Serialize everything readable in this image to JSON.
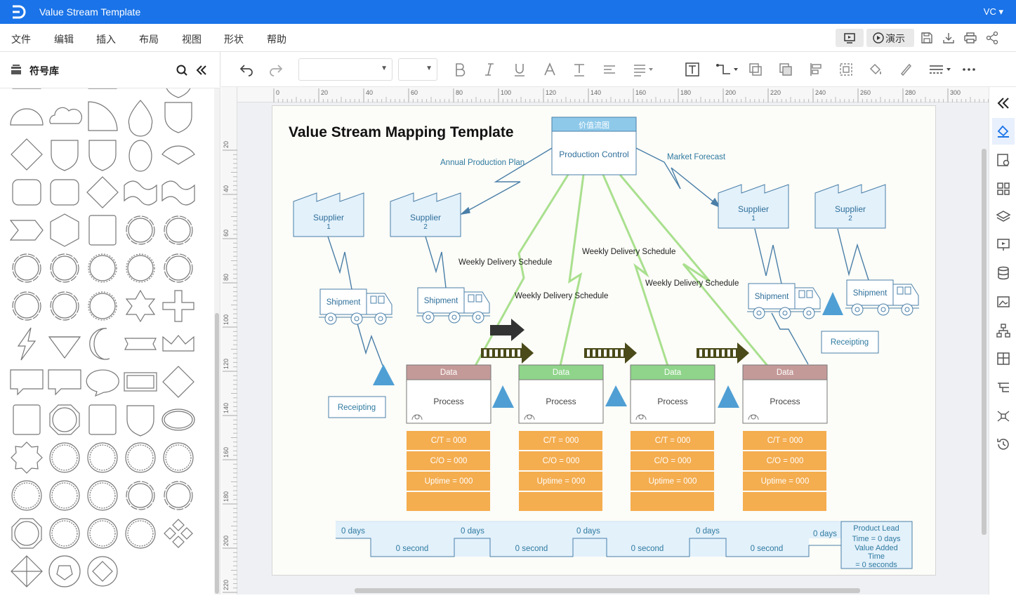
{
  "app": {
    "title": "Value Stream Template",
    "user": "VC"
  },
  "menu": {
    "items": [
      "文件",
      "编辑",
      "插入",
      "布局",
      "视图",
      "形状",
      "帮助"
    ],
    "present": "演示"
  },
  "sidebar": {
    "title": "符号库"
  },
  "ruler": {
    "h": [
      "0",
      "20",
      "40",
      "60",
      "80",
      "100",
      "120",
      "140",
      "160",
      "180",
      "200",
      "220",
      "240",
      "260",
      "280",
      "300"
    ],
    "v": [
      "20",
      "40",
      "60",
      "80",
      "100",
      "120",
      "140",
      "160",
      "180",
      "200",
      "220"
    ]
  },
  "diagram": {
    "title": "Value Stream Mapping Template",
    "control": {
      "header": "价值流图",
      "label": "Production Control"
    },
    "annual_plan": "Annual Production Plan",
    "market_forecast": "Market Forecast",
    "weekly": "Weekly Delivery Schedule",
    "suppliers": [
      {
        "name": "Supplier",
        "num": "1"
      },
      {
        "name": "Supplier",
        "num": "2"
      },
      {
        "name": "Supplier",
        "num": "1"
      },
      {
        "name": "Supplier",
        "num": "2"
      }
    ],
    "shipment": "Shipment",
    "receipting": "Receipting",
    "process": {
      "header": "Data",
      "label": "Process"
    },
    "data_rows": [
      "C/T = 000",
      "C/O = 000",
      "Uptime = 000"
    ],
    "timeline": {
      "days": "0 days",
      "second": "0 second"
    },
    "lead": {
      "line1": "Product Lead",
      "line2": "Time = 0 days",
      "line3": "Value Added",
      "line4": "Time",
      "line5": "= 0 seconds"
    }
  },
  "colors": {
    "accent": "#1a73e8",
    "orange": "#f4ad4f",
    "green_header": "#8fd48a",
    "red_header": "#c49a98",
    "line_blue": "#4a7fa8",
    "lightning": "#a9e08e"
  }
}
